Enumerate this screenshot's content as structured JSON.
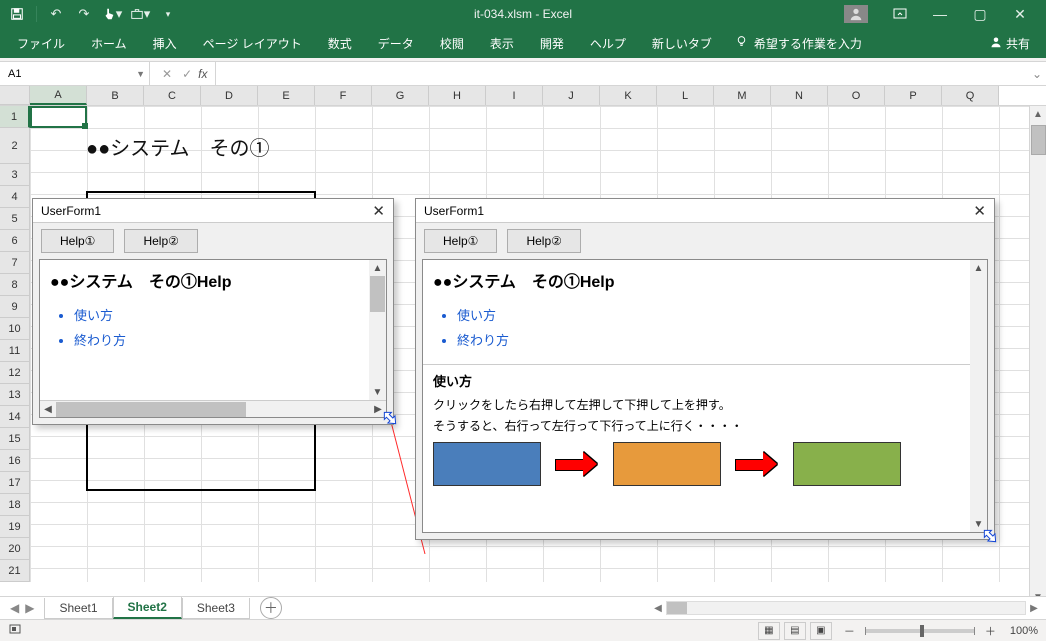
{
  "app": {
    "filename": "it-034.xlsm",
    "product": "Excel",
    "title_sep": " - ",
    "share_label": "共有"
  },
  "qat": {
    "save_icon": "save-icon",
    "splitter": " | ",
    "undo_icon": "undo-icon",
    "redo_icon": "redo-icon",
    "touch_icon": "touch-icon",
    "custom_icon": "briefcase-icon"
  },
  "ribbon": {
    "tabs": [
      "ファイル",
      "ホーム",
      "挿入",
      "ページ レイアウト",
      "数式",
      "データ",
      "校閲",
      "表示",
      "開発",
      "ヘルプ",
      "新しいタブ"
    ],
    "tell_me": "希望する作業を入力"
  },
  "namebox": {
    "value": "A1"
  },
  "columns": [
    "A",
    "B",
    "C",
    "D",
    "E",
    "F",
    "G",
    "H",
    "I",
    "J",
    "K",
    "L",
    "M",
    "N",
    "O",
    "P",
    "Q"
  ],
  "rows": [
    "1",
    "2",
    "3",
    "4",
    "5",
    "6",
    "7",
    "8",
    "9",
    "10",
    "11",
    "12",
    "13",
    "14",
    "15",
    "16",
    "17",
    "18",
    "19",
    "20",
    "21"
  ],
  "sheet_content": {
    "title_cell": "●●システム　その①"
  },
  "userform1": {
    "title": "UserForm1",
    "help1_label": "Help①",
    "help2_label": "Help②",
    "heading": "●●システム　その①Help",
    "link_usage": "使い方",
    "link_finish": "終わり方"
  },
  "userform2": {
    "title": "UserForm1",
    "help1_label": "Help①",
    "help2_label": "Help②",
    "heading": "●●システム　その①Help",
    "link_usage": "使い方",
    "link_finish": "終わり方",
    "section_usage": "使い方",
    "body_line1": "クリックをしたら右押して左押して下押して上を押す。",
    "body_line2": "そうすると、右行って左行って下行って上に行く・・・・",
    "colors": {
      "c1": "#4a7ebb",
      "c2": "#e79a3c",
      "c3": "#88b04b"
    }
  },
  "sheets": {
    "items": [
      "Sheet1",
      "Sheet2",
      "Sheet3"
    ],
    "active_index": 1
  },
  "status": {
    "record_icon": "record-macro-icon",
    "zoom_label": "100%",
    "minus": "－",
    "plus": "＋"
  }
}
